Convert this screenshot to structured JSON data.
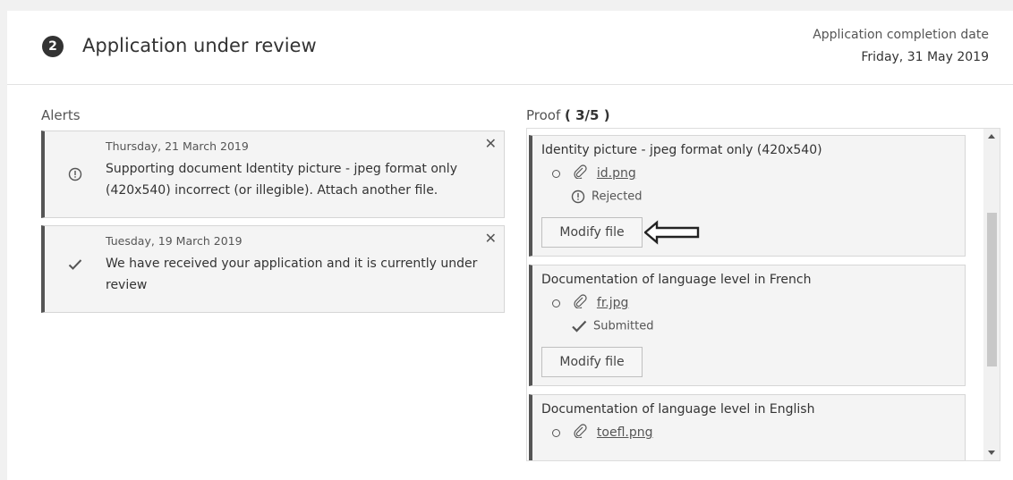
{
  "header": {
    "step_number": "2",
    "title": "Application under review",
    "completion_label": "Application completion date",
    "completion_date": "Friday, 31 May 2019"
  },
  "alerts": {
    "label": "Alerts",
    "items": [
      {
        "icon": "warning-circle-icon",
        "date": "Thursday, 21 March 2019",
        "message": "Supporting document Identity picture - jpeg format only (420x540) incorrect (or illegible). Attach another file."
      },
      {
        "icon": "checkmark-icon",
        "date": "Tuesday, 19 March 2019",
        "message": "We have received your application and it is currently under review"
      }
    ]
  },
  "proof": {
    "label": "Proof",
    "count": "( 3/5 )",
    "items": [
      {
        "title": "Identity picture - jpeg format only (420x540)",
        "file": "id.png",
        "status": "Rejected",
        "status_icon": "warning-circle-icon",
        "button": "Modify file"
      },
      {
        "title": "Documentation of language level in French",
        "file": "fr.jpg",
        "status": "Submitted",
        "status_icon": "checkmark-icon",
        "button": "Modify file"
      },
      {
        "title": "Documentation of language level in English",
        "file": "toefl.png"
      }
    ]
  },
  "colors": {
    "accent": "#555555",
    "panel_bg": "#f4f4f4"
  }
}
